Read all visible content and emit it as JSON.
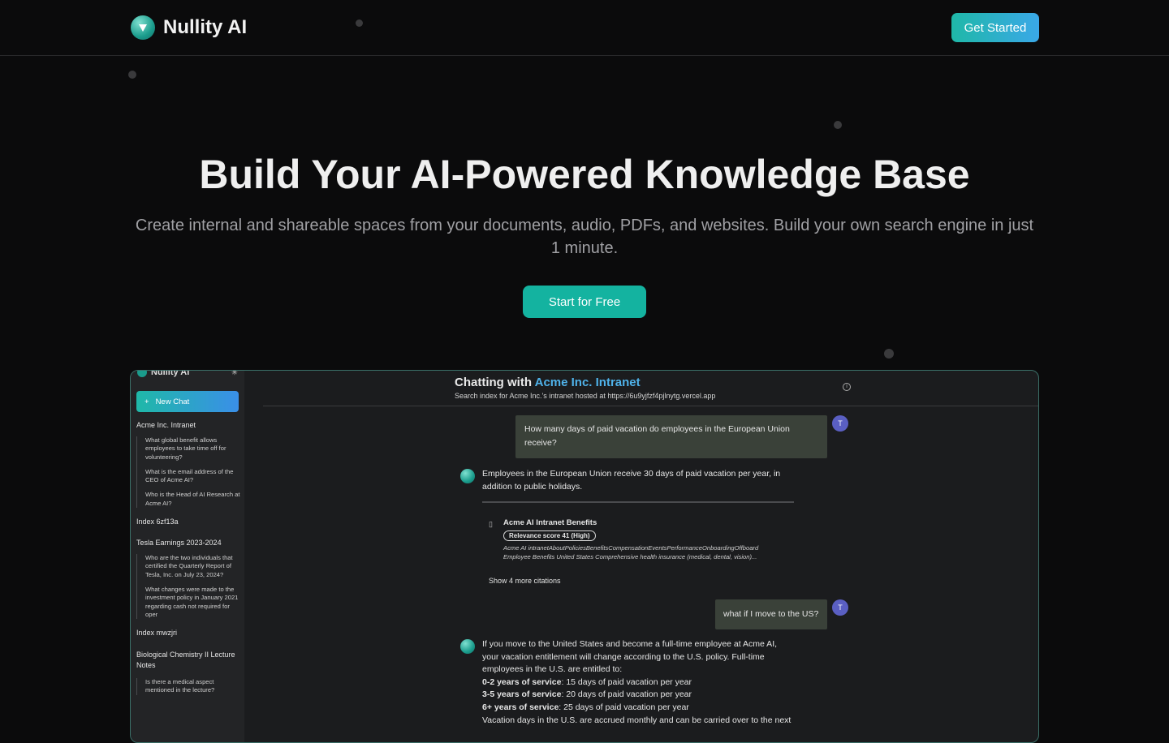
{
  "nav": {
    "brand": "Nullity AI",
    "get_started": "Get Started"
  },
  "hero": {
    "title": "Build Your AI-Powered Knowledge Base",
    "subtitle": "Create internal and shareable spaces from your documents, audio, PDFs, and websites. Build your own search engine in just 1 minute.",
    "cta": "Start for Free"
  },
  "app": {
    "sidebar": {
      "brand": "Nullity AI",
      "new_chat_icon": "+",
      "new_chat": "New Chat",
      "sections": [
        {
          "title": "Acme Inc. Intranet",
          "items": [
            "What global benefit allows employees to take time off for volunteering?",
            "What is the email address of the CEO of Acme AI?",
            "Who is the Head of AI Research at Acme AI?"
          ]
        },
        {
          "title": "Index 6zf13a",
          "items": []
        },
        {
          "title": "Tesla Earnings 2023-2024",
          "items": [
            "Who are the two individuals that certified the Quarterly Report of Tesla, Inc. on July 23, 2024?",
            "What changes were made to the investment policy in January 2021 regarding cash not required for oper"
          ]
        },
        {
          "title": "Index mwzjri",
          "items": []
        },
        {
          "title": "Biological Chemistry II Lecture Notes",
          "items": [
            "Is there a medical aspect mentioned in the lecture?"
          ]
        }
      ]
    },
    "chat": {
      "title_prefix": "Chatting with",
      "title_accent": "Acme Inc. Intranet",
      "subtitle": "Search index for Acme Inc.'s intranet hosted at https://6u9yjfzf4pjlnytg.vercel.app",
      "info": "i",
      "user_avatar": "T",
      "q1_line1": "How many days of paid vacation do employees in the European Union",
      "q1_line2": "receive?",
      "a1_line1": "Employees in the European Union receive 30 days of paid vacation per year, in",
      "a1_line2": "addition to public holidays.",
      "citation": {
        "title": "Acme AI Intranet Benefits",
        "badge": "Relevance score 41 (High)",
        "snippet_line1": "Acme AI intranetAboutPoliciesBenefitsCompensationEventsPerformanceOnboardingOffboard",
        "snippet_line2": "Employee Benefits United States Comprehensive health insurance (medical, dental, vision)..."
      },
      "show_more": "Show 4 more citations",
      "q2": "what if I move to the US?",
      "a2_line1": "If you move to the United States and become a full-time employee at Acme AI,",
      "a2_line2": "your vacation entitlement will change according to the U.S. policy. Full-time",
      "a2_line3": "employees in the U.S. are entitled to:",
      "a2_b1_label": "0-2 years of service",
      "a2_b1_text": ": 15 days of paid vacation per year",
      "a2_b2_label": "3-5 years of service",
      "a2_b2_text": ": 20 days of paid vacation per year",
      "a2_b3_label": "6+ years of service",
      "a2_b3_text": ": 25 days of paid vacation per year",
      "a2_line7": "Vacation days in the U.S. are accrued monthly and can be carried over to the next"
    }
  }
}
